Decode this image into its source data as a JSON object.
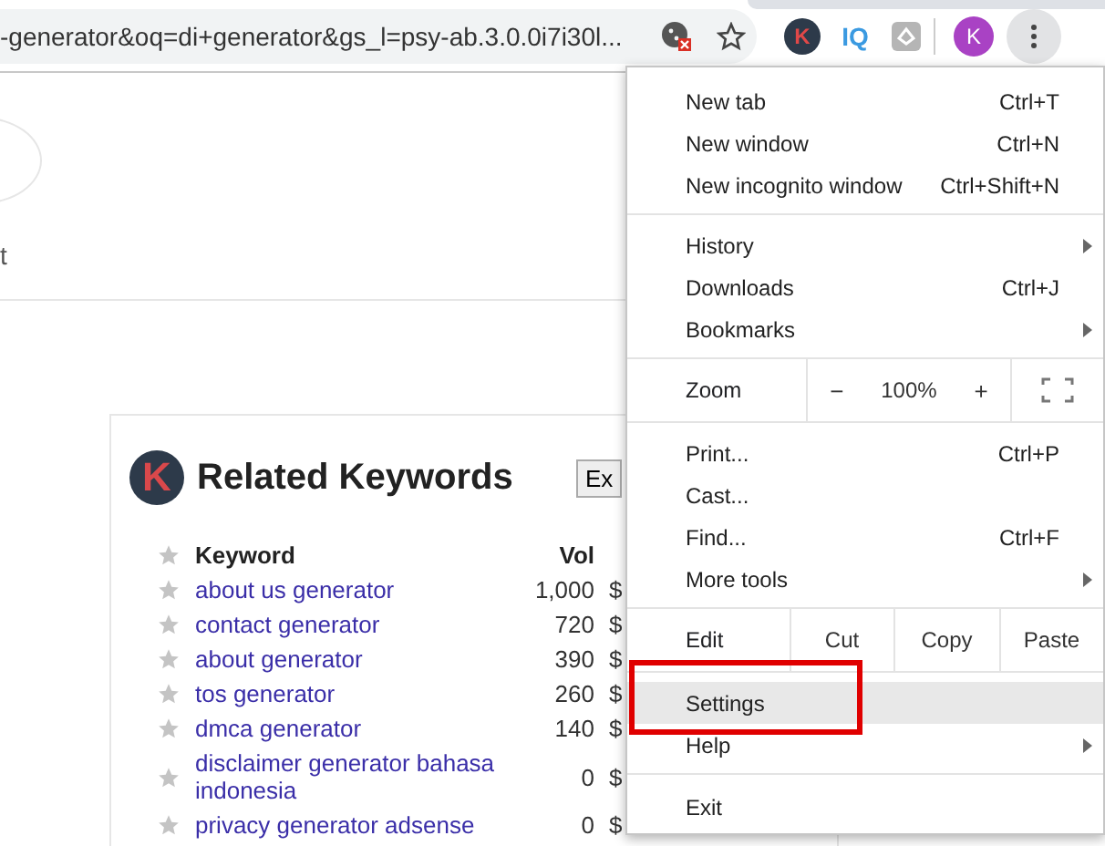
{
  "browser": {
    "address": "-generator&oq=di+generator&gs_l=psy-ab.3.0.0i7i30l...",
    "extensions": [
      {
        "kind": "badge",
        "label": "K"
      },
      {
        "kind": "text",
        "label": "IQ"
      },
      {
        "kind": "grey"
      }
    ],
    "profile_initial": "K"
  },
  "page": {
    "cut_text": "t",
    "panel": {
      "logo_letter": "K",
      "title": "Related Keywords",
      "export_button": "Ex",
      "columns": [
        "Keyword",
        "Vol"
      ],
      "rows": [
        {
          "keyword": "about us generator",
          "vol": "1,000",
          "column_3": "$"
        },
        {
          "keyword": "contact generator",
          "vol": "720",
          "column_3": "$"
        },
        {
          "keyword": "about generator",
          "vol": "390",
          "column_3": "$"
        },
        {
          "keyword": "tos generator",
          "vol": "260",
          "column_3": "$"
        },
        {
          "keyword": "dmca generator",
          "vol": "140",
          "column_3": "$"
        },
        {
          "keyword": "disclaimer generator bahasa indonesia",
          "vol": "0",
          "column_3": "$"
        },
        {
          "keyword": "privacy generator adsense",
          "vol": "0",
          "column_3": "$"
        }
      ]
    }
  },
  "menu": {
    "sections": [
      [
        {
          "kind": "item",
          "label": "New tab",
          "shortcut": "Ctrl+T",
          "submenu": false,
          "selected": false,
          "annotated": false
        },
        {
          "kind": "item",
          "label": "New window",
          "shortcut": "Ctrl+N",
          "submenu": false,
          "selected": false,
          "annotated": false
        },
        {
          "kind": "item",
          "label": "New incognito window",
          "shortcut": "Ctrl+Shift+N",
          "submenu": false,
          "selected": false,
          "annotated": false
        }
      ],
      [
        {
          "kind": "item",
          "label": "History",
          "submenu": true,
          "selected": false,
          "annotated": false
        },
        {
          "kind": "item",
          "label": "Downloads",
          "shortcut": "Ctrl+J",
          "submenu": false,
          "selected": false,
          "annotated": false
        },
        {
          "kind": "item",
          "label": "Bookmarks",
          "submenu": true,
          "selected": false,
          "annotated": false
        }
      ],
      [
        {
          "kind": "zoom",
          "label": "Zoom",
          "minus": "−",
          "value": "100%",
          "plus": "+"
        }
      ],
      [
        {
          "kind": "item",
          "label": "Print...",
          "shortcut": "Ctrl+P",
          "submenu": false,
          "selected": false,
          "annotated": false
        },
        {
          "kind": "item",
          "label": "Cast...",
          "submenu": false,
          "selected": false,
          "annotated": false
        },
        {
          "kind": "item",
          "label": "Find...",
          "shortcut": "Ctrl+F",
          "submenu": false,
          "selected": false,
          "annotated": false
        },
        {
          "kind": "item",
          "label": "More tools",
          "submenu": true,
          "selected": false,
          "annotated": false
        }
      ],
      [
        {
          "kind": "edit",
          "label": "Edit",
          "buttons": [
            "Cut",
            "Copy",
            "Paste"
          ]
        }
      ],
      [
        {
          "kind": "item",
          "label": "Settings",
          "submenu": false,
          "selected": true,
          "annotated": true
        },
        {
          "kind": "item",
          "label": "Help",
          "submenu": true,
          "selected": false,
          "annotated": false
        }
      ],
      [
        {
          "kind": "item",
          "label": "Exit",
          "submenu": false,
          "selected": false,
          "annotated": false
        }
      ]
    ]
  }
}
